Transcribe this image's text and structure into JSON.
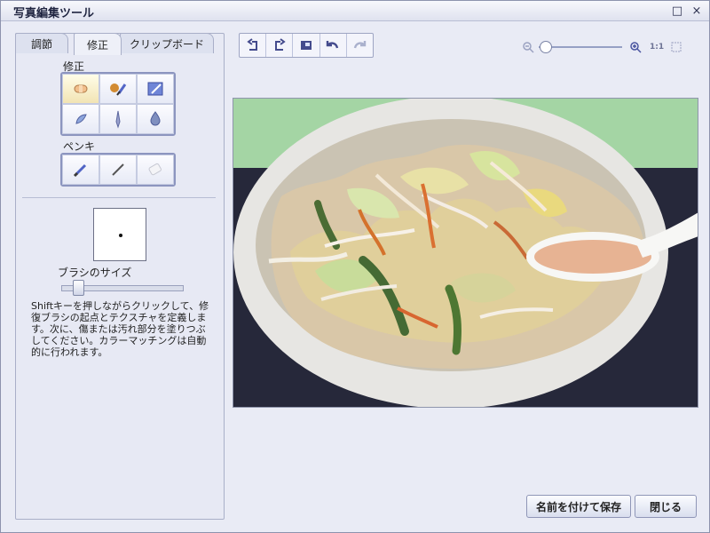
{
  "window": {
    "title": "写真編集ツール",
    "maximize_icon": "□",
    "close_icon": "×"
  },
  "left_panel": {
    "tabs": [
      {
        "label": "調節"
      },
      {
        "label": "修正"
      },
      {
        "label": "クリップボード"
      }
    ],
    "repair_label": "修正",
    "paint_label": "ペンキ",
    "brush_size_label": "ブラシのサイズ",
    "brush_size": 0.1,
    "instruction_text": "Shiftキーを押しながらクリックして、修復ブラシの起点とテクスチャを定義します。次に、傷または汚れ部分を塗りつぶしてください。カラーマッチングは自動的に行われます。"
  },
  "toolbar": {
    "tools": [
      {
        "icon": "rotate-left-icon"
      },
      {
        "icon": "rotate-right-icon"
      },
      {
        "icon": "resize-icon"
      },
      {
        "icon": "undo-icon"
      },
      {
        "icon": "redo-icon"
      }
    ]
  },
  "zoom": {
    "label": "1:1",
    "level": 0.02
  },
  "buttons": {
    "save_as": "名前を付けて保存",
    "close": "閉じる"
  }
}
